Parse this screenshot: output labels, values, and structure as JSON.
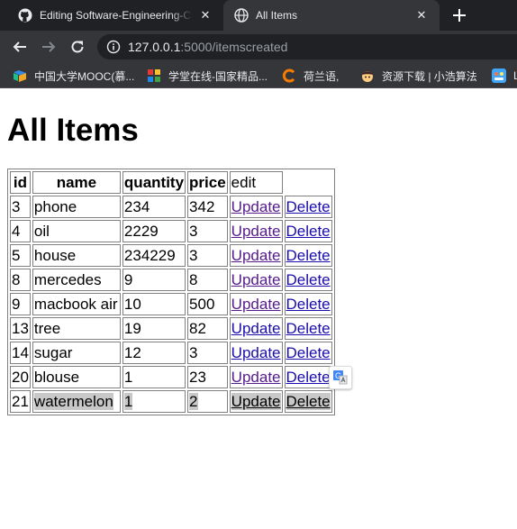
{
  "browser": {
    "tabs": [
      {
        "title": "Editing Software-Engineering-Cr",
        "icon": "github-icon",
        "active": false
      },
      {
        "title": "All Items",
        "icon": "globe-icon",
        "active": true
      }
    ],
    "address": {
      "host": "127.0.0.1",
      "path": ":5000/itemscreated"
    },
    "bookmarks": [
      {
        "label": "中国大学MOOC(慕...",
        "icon": "mooc-icon"
      },
      {
        "label": "学堂在线-国家精品...",
        "icon": "xuetang-icon"
      },
      {
        "label": "荷兰语,",
        "icon": "c-orange-icon"
      },
      {
        "label": "资源下载 | 小浩算法",
        "icon": "avatar-icon"
      },
      {
        "label": "L",
        "icon": "app-icon"
      }
    ]
  },
  "page": {
    "title": "All Items",
    "table": {
      "headers": [
        "id",
        "name",
        "quantity",
        "price",
        "edit"
      ],
      "update_label": "Update",
      "delete_label": "Delete",
      "rows": [
        {
          "id": "3",
          "name": "phone",
          "quantity": "234",
          "price": "342"
        },
        {
          "id": "4",
          "name": "oil",
          "quantity": "2229",
          "price": "3"
        },
        {
          "id": "5",
          "name": "house",
          "quantity": "234229",
          "price": "3"
        },
        {
          "id": "8",
          "name": "mercedes",
          "quantity": "9",
          "price": "8"
        },
        {
          "id": "9",
          "name": "macbook air",
          "quantity": "10",
          "price": "500"
        },
        {
          "id": "13",
          "name": "tree",
          "quantity": "19",
          "price": "82"
        },
        {
          "id": "14",
          "name": "sugar",
          "quantity": "12",
          "price": "3"
        },
        {
          "id": "20",
          "name": "blouse",
          "quantity": "1",
          "price": "23"
        },
        {
          "id": "21",
          "name": "watermelon",
          "quantity": "1",
          "price": "2"
        }
      ]
    }
  },
  "colors": {
    "tabstrip": "#202124",
    "toolbar": "#35363a",
    "link": "#1a0dab",
    "visited_link": "#551a8b",
    "selection": "#c8c8c8"
  }
}
